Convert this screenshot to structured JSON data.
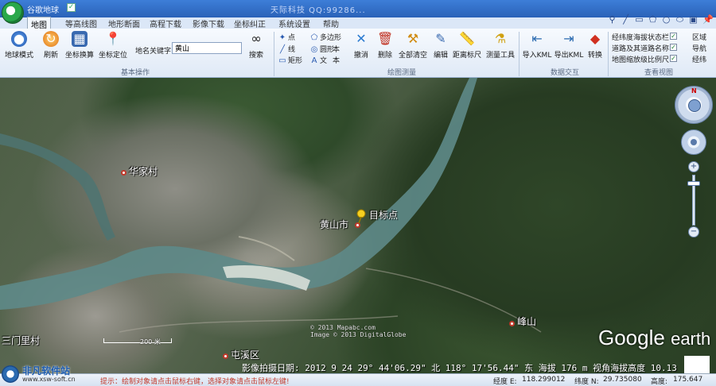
{
  "app": {
    "title": "谷歌地球",
    "window_caption": "天际科技  QQ:99286...",
    "title_check": "✓"
  },
  "tabs": [
    "地图",
    "等高线图",
    "地形断面",
    "高程下载",
    "影像下载",
    "坐标纠正",
    "系统设置",
    "帮助"
  ],
  "toolbar_right_icons": [
    "pin-icon",
    "line-icon",
    "rect-icon",
    "polygon-icon",
    "circle-icon",
    "ellipse-icon",
    "image-icon",
    "yellow-pin-icon"
  ],
  "ribbon": {
    "basic": {
      "label": "基本操作",
      "earth_mode": "地球模式",
      "refresh": "刷新",
      "coord_convert": "坐标换算",
      "coord_locate": "坐标定位",
      "search_label": "地名关键字:",
      "search_value": "黄山",
      "search_button": "搜索"
    },
    "draw": {
      "label": "绘图测量",
      "point": "点",
      "line": "线",
      "rect": "矩形",
      "polygon": "多边形",
      "circle": "圆形",
      "text": "文",
      "text2": "本",
      "cancel": "撤消",
      "delete": "删除",
      "clear_all": "全部清空",
      "edit": "编辑",
      "distance": "距离标尺",
      "measure": "测量工具"
    },
    "data": {
      "label": "数据交互",
      "import_kml": "导入KML",
      "export_kml": "导出KML",
      "convert": "转换"
    },
    "view": {
      "label": "查看视图",
      "checks": [
        {
          "label": "经纬度海拔状态栏",
          "checked": true
        },
        {
          "label": "道路及其道路名称",
          "checked": true
        },
        {
          "label": "地图缩放级比例尺",
          "checked": true
        }
      ],
      "extra": [
        "区域",
        "导航",
        "经纬"
      ]
    }
  },
  "map": {
    "places": [
      {
        "name": "华家村"
      },
      {
        "name": "黄山市"
      },
      {
        "name": "目标点"
      },
      {
        "name": "峰山"
      },
      {
        "name": "三门里村"
      },
      {
        "name": "屯溪区"
      }
    ],
    "scale_label": "200 米",
    "copyright": "© 2013 Mapabc.com\nImage © 2013 DigitalGlobe",
    "brand": "Google",
    "brand_suffix": "earth",
    "overlay_status": "影像拍摄日期: 2012 9 24   29° 44'06.29\" 北 118° 17'56.44\" 东 海拔   176 m   视角海拔高度   10.13"
  },
  "statusbar": {
    "logo_text": "非凡软件站",
    "logo_url": "www.xsw-soft.cn",
    "hint_prefix": "提示：",
    "hint": "绘制对象请点击鼠标右键，选择对象请点击鼠标左键!",
    "lon_label": "经度 E:",
    "lon": "118.299012",
    "lat_label": "纬度 N:",
    "lat": "29.735080",
    "alt_label": "高度:",
    "alt": "175.647"
  },
  "colors": {
    "accent": "#2a62b8",
    "ribbon_bg": "#dfe9f6",
    "place_marker": "#c0392b",
    "hint": "#c0392b"
  }
}
